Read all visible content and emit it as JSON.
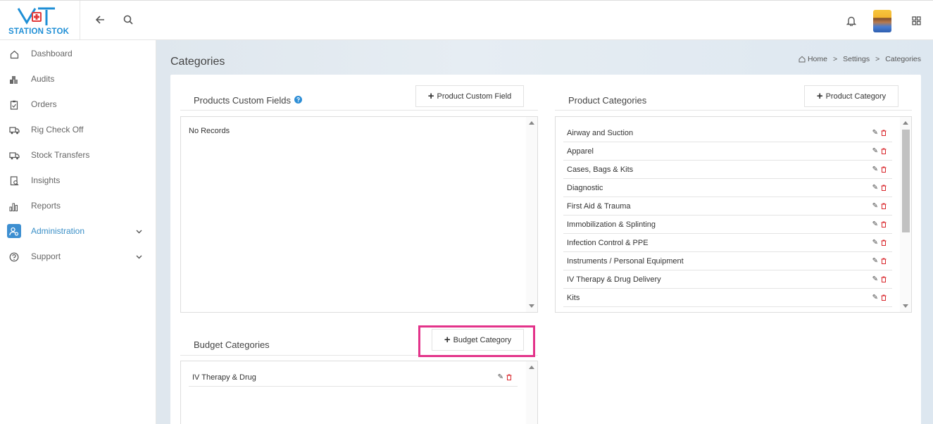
{
  "brand": {
    "name": "STATION STOK",
    "color": "#1f8fd6"
  },
  "topbar": {
    "back_icon": "arrow-left-icon",
    "search_icon": "search-icon",
    "bell_icon": "bell-icon",
    "apps_icon": "grid-icon"
  },
  "sidebar": {
    "items": [
      {
        "label": "Dashboard",
        "icon": "home-icon"
      },
      {
        "label": "Audits",
        "icon": "boxes-icon"
      },
      {
        "label": "Orders",
        "icon": "clipboard-icon"
      },
      {
        "label": "Rig Check Off",
        "icon": "truck-icon"
      },
      {
        "label": "Stock Transfers",
        "icon": "transfer-truck-icon"
      },
      {
        "label": "Insights",
        "icon": "report-search-icon"
      },
      {
        "label": "Reports",
        "icon": "bar-chart-icon"
      },
      {
        "label": "Administration",
        "icon": "user-settings-icon",
        "active": true,
        "expandable": true
      },
      {
        "label": "Support",
        "icon": "question-circle-icon",
        "expandable": true
      }
    ]
  },
  "page": {
    "title": "Categories",
    "breadcrumb": [
      "Home",
      ">",
      "Settings",
      ">",
      "Categories"
    ]
  },
  "products_custom_fields": {
    "title": "Products Custom Fields",
    "add_button": "Product Custom Field",
    "empty_text": "No Records"
  },
  "product_categories": {
    "title": "Product Categories",
    "add_button": "Product Category",
    "items": [
      "Airway and Suction",
      "Apparel",
      "Cases, Bags & Kits",
      "Diagnostic",
      "First Aid & Trauma",
      "Immobilization & Splinting",
      "Infection Control & PPE",
      "Instruments / Personal Equipment",
      "IV Therapy & Drug Delivery",
      "Kits"
    ]
  },
  "budget_categories": {
    "title": "Budget Categories",
    "add_button": "Budget Category",
    "items": [
      "IV Therapy & Drug"
    ]
  },
  "colors": {
    "accent": "#3d8fd1",
    "highlight": "#e3338a",
    "delete": "#d9262b"
  }
}
